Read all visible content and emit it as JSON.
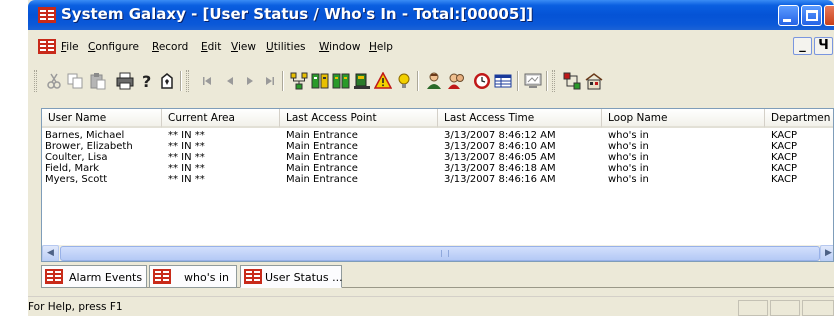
{
  "window": {
    "title": "System Galaxy - [User Status / Who's In - Total:[00005]]"
  },
  "menu": {
    "items": [
      {
        "accel": "F",
        "rest": "ile"
      },
      {
        "accel": "C",
        "rest": "onfigure"
      },
      {
        "accel": "R",
        "rest": "ecord"
      },
      {
        "accel": "E",
        "rest": "dit"
      },
      {
        "accel": "V",
        "rest": "iew"
      },
      {
        "accel": "U",
        "rest": "tilities"
      },
      {
        "accel": "W",
        "rest": "indow"
      },
      {
        "accel": "H",
        "rest": "elp"
      }
    ],
    "mdi_minimize": "_",
    "mdi_restore": "Ч"
  },
  "toolbar": {
    "icons": [
      "cut-icon",
      "copy-icon",
      "paste-icon",
      "print-icon",
      "help-icon",
      "about-icon",
      "first-record-icon",
      "previous-record-icon",
      "next-record-icon",
      "last-record-icon",
      "hardware-tree-icon",
      "loop-status-icon",
      "loop-config-icon",
      "alarm-icon",
      "warning-icon",
      "event-icon",
      "cardholder-icon",
      "badge-icon",
      "clock-icon",
      "grid-icon",
      "monitor-icon",
      "door-control-icon",
      "building-icon"
    ]
  },
  "list": {
    "columns": [
      "User Name",
      "Current Area",
      "Last Access Point",
      "Last Access Time",
      "Loop Name",
      "Departmen"
    ],
    "rows": [
      [
        "Barnes, Michael",
        "** IN **",
        "Main Entrance",
        "3/13/2007 8:46:12 AM",
        "who's in",
        "KACP"
      ],
      [
        "Brower, Elizabeth",
        "** IN **",
        "Main Entrance",
        "3/13/2007 8:46:10 AM",
        "who's in",
        "KACP"
      ],
      [
        "Coulter, Lisa",
        "** IN **",
        "Main Entrance",
        "3/13/2007 8:46:05 AM",
        "who's in",
        "KACP"
      ],
      [
        "Field, Mark",
        "** IN **",
        "Main Entrance",
        "3/13/2007 8:46:18 AM",
        "who's in",
        "KACP"
      ],
      [
        "Myers, Scott",
        "** IN **",
        "Main Entrance",
        "3/13/2007 8:46:16 AM",
        "who's in",
        "KACP"
      ]
    ]
  },
  "tabs": [
    {
      "label": "Alarm Events",
      "active": false
    },
    {
      "label": "who's in",
      "active": false
    },
    {
      "label": "User Status ...",
      "active": true
    }
  ],
  "status": {
    "text": "For Help, press F1"
  },
  "colors": {
    "titlebar": "#0553d6",
    "window_face": "#ece9d8",
    "app_icon_red": "#c82a1a"
  }
}
